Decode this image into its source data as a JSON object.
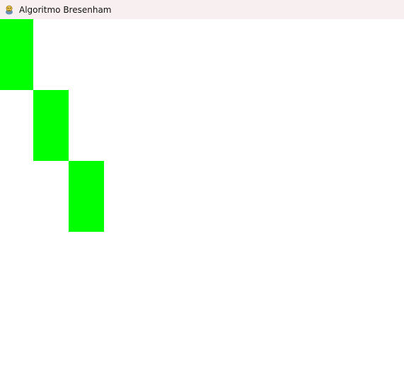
{
  "window": {
    "title": "Algoritmo Bresenham",
    "icon": "pygame-snake-icon"
  },
  "canvas": {
    "background": "#ffffff",
    "pixel_color": "#00ff00",
    "pixels": [
      {
        "col": 0,
        "row": 0
      },
      {
        "col": 1,
        "row": 1
      },
      {
        "col": 2,
        "row": 2
      }
    ]
  }
}
